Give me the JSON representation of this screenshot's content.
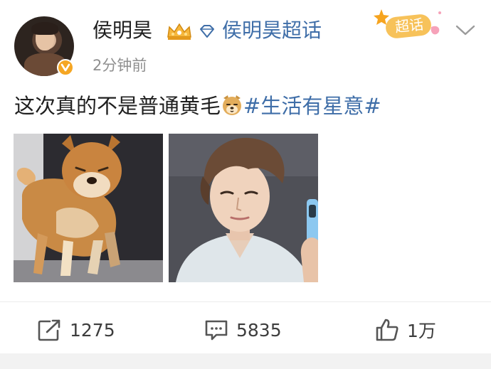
{
  "post": {
    "username": "侯明昊",
    "topic_link": "侯明昊超话",
    "time_ago": "2分钟前",
    "badge_label": "超话",
    "text_main": "这次真的不是普通黄毛",
    "hashtag": "#生活有星意#"
  },
  "actions": {
    "repost_count": "1275",
    "comment_count": "5835",
    "like_count": "1万"
  },
  "colors": {
    "link": "#3f6ea8",
    "badge": "#f5a623",
    "badge_pink": "#f6a2b9"
  },
  "icons": [
    "crown-icon",
    "diamond-icon",
    "verified-icon",
    "chevron-down-icon",
    "dog-emoji-icon",
    "repost-icon",
    "comment-icon",
    "like-icon"
  ]
}
